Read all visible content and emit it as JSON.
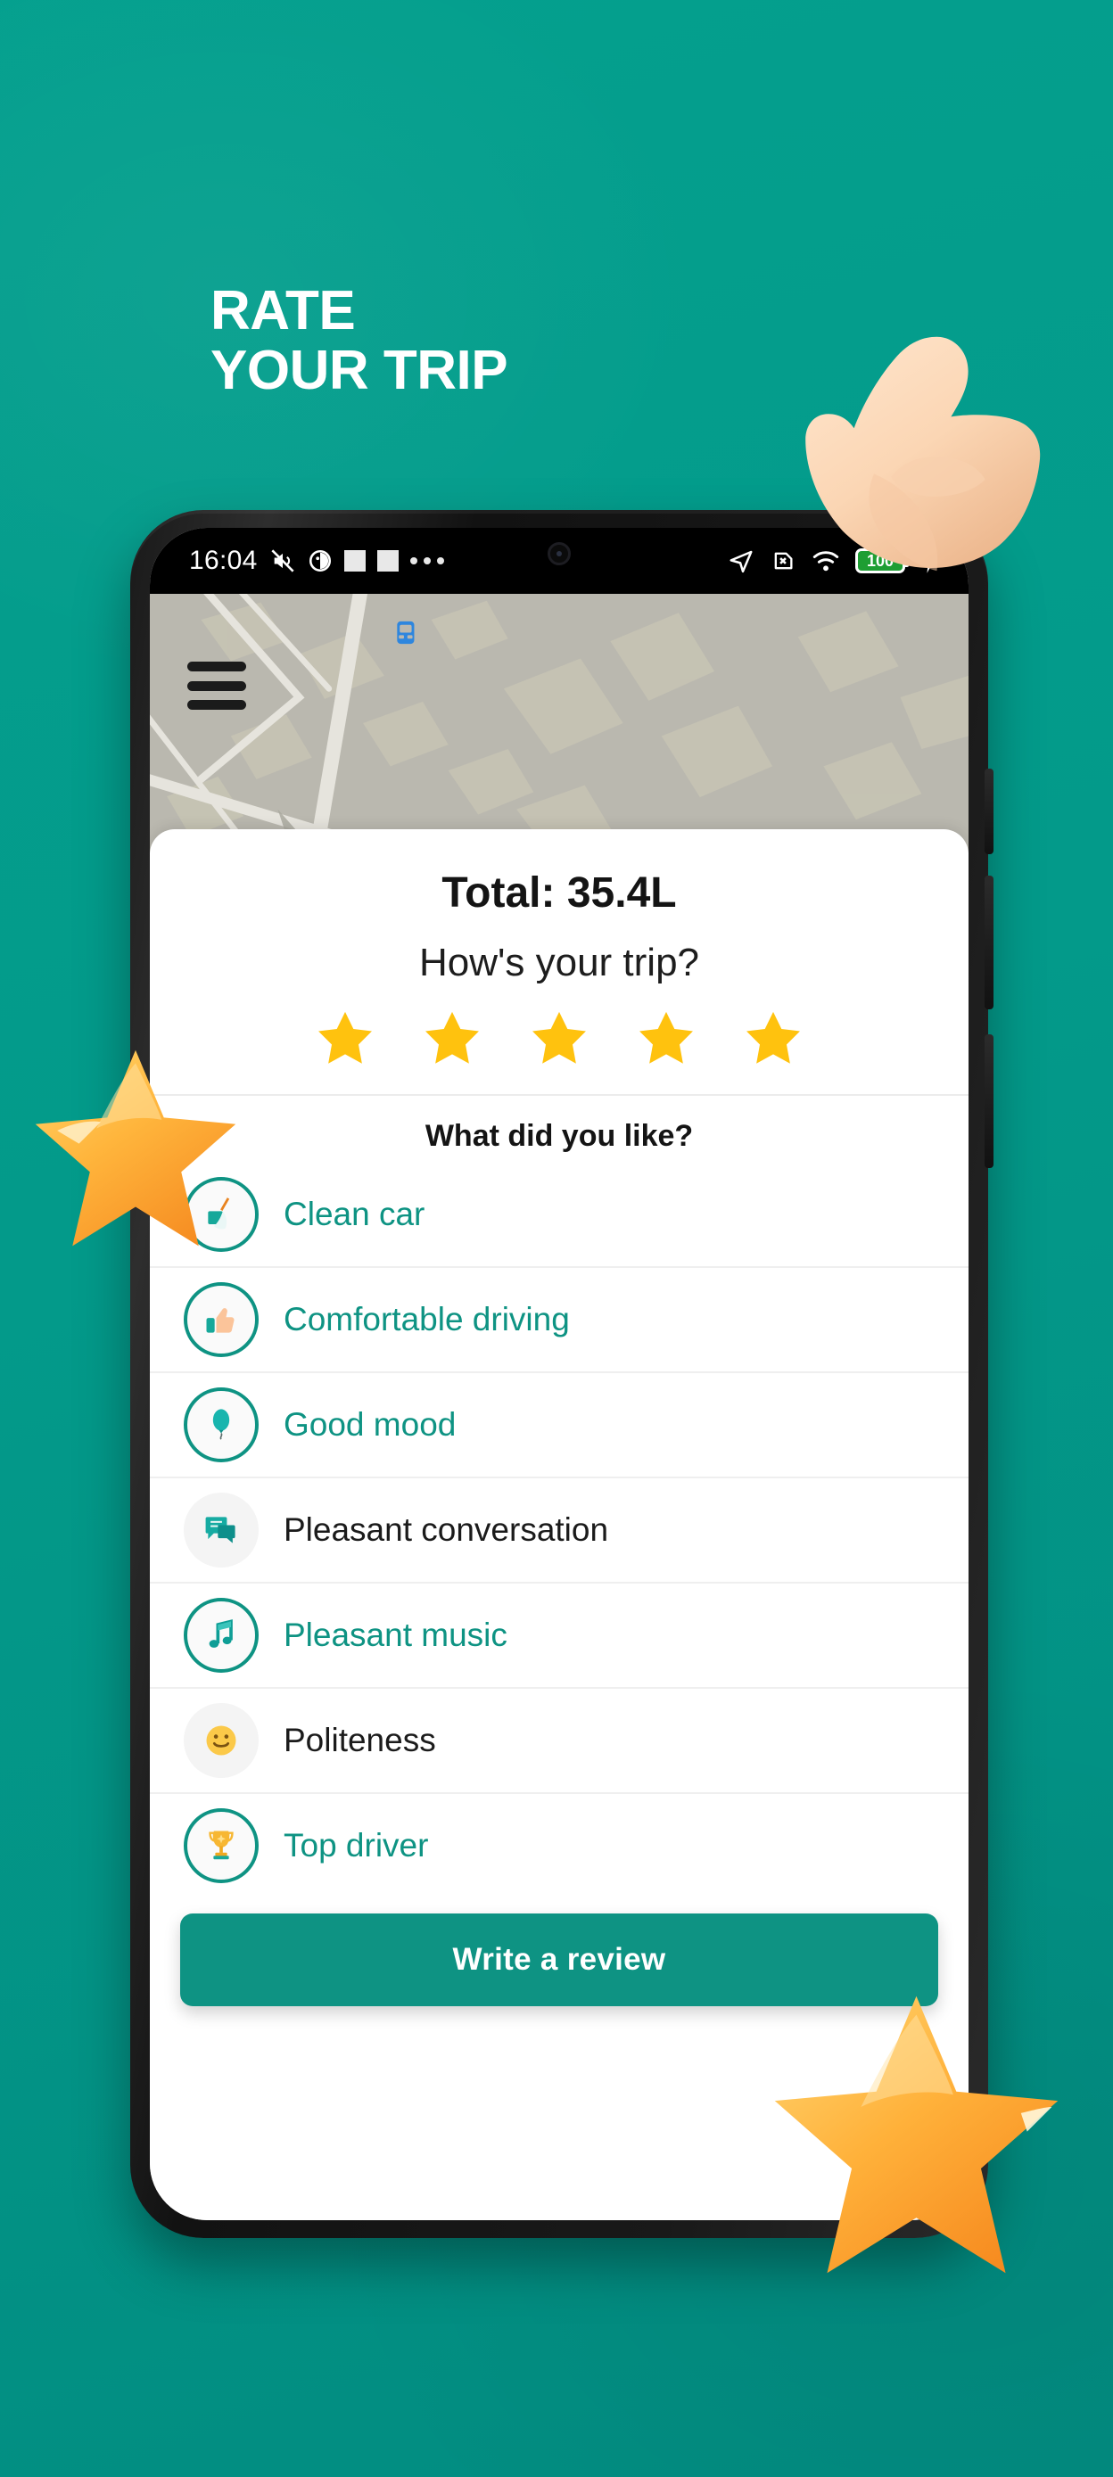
{
  "theme": {
    "brand_teal": "#0E9383",
    "background_teal": "#059C8B",
    "star_gold": "#FFC20E",
    "deco_orange": "#FFB23F",
    "battery_green": "#1E9E33"
  },
  "promo": {
    "headline_line1": "RATE",
    "headline_line2": "YOUR TRIP",
    "decorations": [
      {
        "name": "thumbs-up-3d",
        "glyph": "👍"
      },
      {
        "name": "star-3d-left",
        "glyph": "★"
      },
      {
        "name": "star-3d-right",
        "glyph": "★"
      }
    ]
  },
  "statusbar": {
    "time": "16:04",
    "left_icons": [
      "silent-vibrate-icon",
      "alarm-icon",
      "app-square-icon",
      "app-square-icon",
      "overflow-dots-icon"
    ],
    "right_icons": [
      "location-arrow-icon",
      "no-sim-icon",
      "wifi-icon",
      "battery-icon",
      "charging-bolt-icon"
    ],
    "battery_level": "100"
  },
  "map": {
    "menu_icon": "hamburger-menu-icon",
    "vehicle_marker": "bus-marker-icon"
  },
  "sheet": {
    "total_label": "Total: 35.4L",
    "question": "How's your trip?",
    "rating": {
      "max": 5,
      "value": 5,
      "star_icon": "star-icon"
    },
    "section_title": "What did you like?",
    "options": [
      {
        "label": "Clean car",
        "icon": "broom-icon",
        "emoji": "🧹",
        "selected": true
      },
      {
        "label": "Comfortable driving",
        "icon": "thumbs-up-icon",
        "emoji": "👍",
        "selected": true
      },
      {
        "label": "Good mood",
        "icon": "balloon-icon",
        "emoji": "🎈",
        "selected": true
      },
      {
        "label": "Pleasant conversation",
        "icon": "chat-bubble-icon",
        "emoji": "💬",
        "selected": false
      },
      {
        "label": "Pleasant music",
        "icon": "music-note-icon",
        "emoji": "🎵",
        "selected": true
      },
      {
        "label": "Politeness",
        "icon": "smiley-face-icon",
        "emoji": "🙂",
        "selected": false
      },
      {
        "label": "Top driver",
        "icon": "trophy-icon",
        "emoji": "🏆",
        "selected": true
      }
    ],
    "cta_label": "Write a review"
  }
}
